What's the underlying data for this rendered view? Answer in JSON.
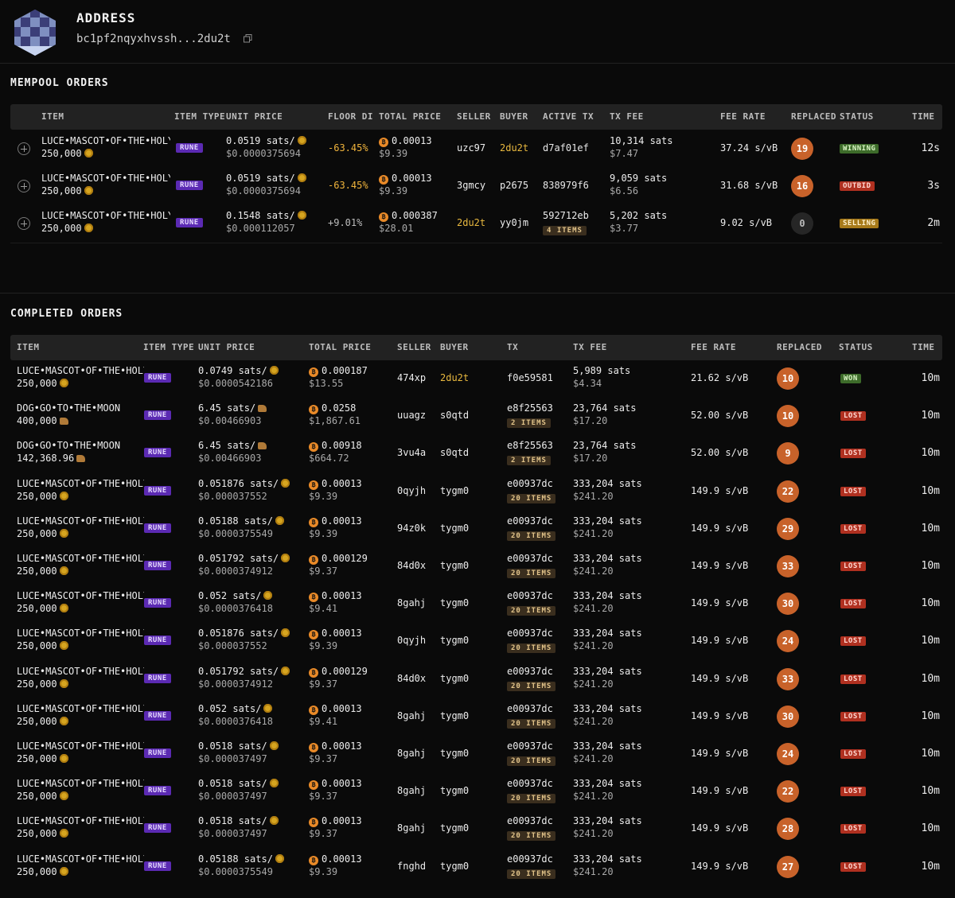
{
  "header": {
    "title": "ADDRESS",
    "address": "bc1pf2nqyxhvssh...2du2t"
  },
  "mempool": {
    "title": "MEMPOOL ORDERS",
    "columns": [
      "ITEM",
      "ITEM TYPE",
      "UNIT PRICE",
      "FLOOR DIFF",
      "TOTAL PRICE",
      "SELLER",
      "BUYER",
      "ACTIVE TX",
      "TX FEE",
      "FEE RATE",
      "REPLACED",
      "STATUS",
      "TIME"
    ],
    "rows": [
      {
        "name": "LUCE•MASCOT•OF•THE•HOLY",
        "amount": "250,000",
        "type": "RUNE",
        "unit": "0.0519 sats/",
        "unit_usd": "$0.0000375694",
        "floor": "-63.45%",
        "total": "0.00013",
        "total_usd": "$9.39",
        "seller": "uzc97",
        "buyer": "2du2t",
        "tx": "d7af01ef",
        "tx_items": "",
        "fee": "10,314 sats",
        "fee_usd": "$7.47",
        "rate": "37.24 s/vB",
        "replaced": "19",
        "status": "WINNING",
        "time": "12s"
      },
      {
        "name": "LUCE•MASCOT•OF•THE•HOLY",
        "amount": "250,000",
        "type": "RUNE",
        "unit": "0.0519 sats/",
        "unit_usd": "$0.0000375694",
        "floor": "-63.45%",
        "total": "0.00013",
        "total_usd": "$9.39",
        "seller": "3gmcy",
        "buyer": "p2675",
        "tx": "838979f6",
        "tx_items": "",
        "fee": "9,059 sats",
        "fee_usd": "$6.56",
        "rate": "31.68 s/vB",
        "replaced": "16",
        "status": "OUTBID",
        "time": "3s"
      },
      {
        "name": "LUCE•MASCOT•OF•THE•HOLY",
        "amount": "250,000",
        "type": "RUNE",
        "unit": "0.1548 sats/",
        "unit_usd": "$0.000112057",
        "floor": "+9.01%",
        "total": "0.000387",
        "total_usd": "$28.01",
        "seller": "2du2t",
        "buyer": "yy0jm",
        "tx": "592712eb",
        "tx_items": "4 ITEMS",
        "fee": "5,202 sats",
        "fee_usd": "$3.77",
        "rate": "9.02 s/vB",
        "replaced": "0",
        "status": "SELLING",
        "time": "2m"
      }
    ]
  },
  "completed": {
    "title": "COMPLETED ORDERS",
    "columns": [
      "ITEM",
      "ITEM TYPE",
      "UNIT PRICE",
      "TOTAL PRICE",
      "SELLER",
      "BUYER",
      "TX",
      "TX FEE",
      "FEE RATE",
      "REPLACED",
      "STATUS",
      "TIME"
    ],
    "rows": [
      {
        "name": "LUCE•MASCOT•OF•THE•HOLY",
        "amount": "250,000",
        "type": "RUNE",
        "unit": "0.0749 sats/",
        "unit_usd": "$0.0000542186",
        "total": "0.000187",
        "total_usd": "$13.55",
        "seller": "474xp",
        "buyer": "2du2t",
        "tx": "f0e59581",
        "tx_items": "",
        "fee": "5,989 sats",
        "fee_usd": "$4.34",
        "rate": "21.62 s/vB",
        "replaced": "10",
        "status": "WON",
        "time": "10m"
      },
      {
        "name": "DOG•GO•TO•THE•MOON",
        "amount": "400,000",
        "type": "RUNE",
        "unit": "6.45 sats/",
        "unit_usd": "$0.00466903",
        "total": "0.0258",
        "total_usd": "$1,867.61",
        "seller": "uuagz",
        "buyer": "s0qtd",
        "tx": "e8f25563",
        "tx_items": "2 ITEMS",
        "fee": "23,764 sats",
        "fee_usd": "$17.20",
        "rate": "52.00 s/vB",
        "replaced": "10",
        "status": "LOST",
        "time": "10m",
        "dog": true
      },
      {
        "name": "DOG•GO•TO•THE•MOON",
        "amount": "142,368.96",
        "type": "RUNE",
        "unit": "6.45 sats/",
        "unit_usd": "$0.00466903",
        "total": "0.00918",
        "total_usd": "$664.72",
        "seller": "3vu4a",
        "buyer": "s0qtd",
        "tx": "e8f25563",
        "tx_items": "2 ITEMS",
        "fee": "23,764 sats",
        "fee_usd": "$17.20",
        "rate": "52.00 s/vB",
        "replaced": "9",
        "status": "LOST",
        "time": "10m",
        "dog": true
      },
      {
        "name": "LUCE•MASCOT•OF•THE•HOLY",
        "amount": "250,000",
        "type": "RUNE",
        "unit": "0.051876 sats/",
        "unit_usd": "$0.000037552",
        "total": "0.00013",
        "total_usd": "$9.39",
        "seller": "0qyjh",
        "buyer": "tygm0",
        "tx": "e00937dc",
        "tx_items": "20 ITEMS",
        "fee": "333,204 sats",
        "fee_usd": "$241.20",
        "rate": "149.9 s/vB",
        "replaced": "22",
        "status": "LOST",
        "time": "10m"
      },
      {
        "name": "LUCE•MASCOT•OF•THE•HOLY",
        "amount": "250,000",
        "type": "RUNE",
        "unit": "0.05188 sats/",
        "unit_usd": "$0.0000375549",
        "total": "0.00013",
        "total_usd": "$9.39",
        "seller": "94z0k",
        "buyer": "tygm0",
        "tx": "e00937dc",
        "tx_items": "20 ITEMS",
        "fee": "333,204 sats",
        "fee_usd": "$241.20",
        "rate": "149.9 s/vB",
        "replaced": "29",
        "status": "LOST",
        "time": "10m"
      },
      {
        "name": "LUCE•MASCOT•OF•THE•HOLY",
        "amount": "250,000",
        "type": "RUNE",
        "unit": "0.051792 sats/",
        "unit_usd": "$0.0000374912",
        "total": "0.000129",
        "total_usd": "$9.37",
        "seller": "84d0x",
        "buyer": "tygm0",
        "tx": "e00937dc",
        "tx_items": "20 ITEMS",
        "fee": "333,204 sats",
        "fee_usd": "$241.20",
        "rate": "149.9 s/vB",
        "replaced": "33",
        "status": "LOST",
        "time": "10m"
      },
      {
        "name": "LUCE•MASCOT•OF•THE•HOLY",
        "amount": "250,000",
        "type": "RUNE",
        "unit": "0.052 sats/",
        "unit_usd": "$0.0000376418",
        "total": "0.00013",
        "total_usd": "$9.41",
        "seller": "8gahj",
        "buyer": "tygm0",
        "tx": "e00937dc",
        "tx_items": "20 ITEMS",
        "fee": "333,204 sats",
        "fee_usd": "$241.20",
        "rate": "149.9 s/vB",
        "replaced": "30",
        "status": "LOST",
        "time": "10m"
      },
      {
        "name": "LUCE•MASCOT•OF•THE•HOLY",
        "amount": "250,000",
        "type": "RUNE",
        "unit": "0.051876 sats/",
        "unit_usd": "$0.000037552",
        "total": "0.00013",
        "total_usd": "$9.39",
        "seller": "0qyjh",
        "buyer": "tygm0",
        "tx": "e00937dc",
        "tx_items": "20 ITEMS",
        "fee": "333,204 sats",
        "fee_usd": "$241.20",
        "rate": "149.9 s/vB",
        "replaced": "24",
        "status": "LOST",
        "time": "10m"
      },
      {
        "name": "LUCE•MASCOT•OF•THE•HOLY",
        "amount": "250,000",
        "type": "RUNE",
        "unit": "0.051792 sats/",
        "unit_usd": "$0.0000374912",
        "total": "0.000129",
        "total_usd": "$9.37",
        "seller": "84d0x",
        "buyer": "tygm0",
        "tx": "e00937dc",
        "tx_items": "20 ITEMS",
        "fee": "333,204 sats",
        "fee_usd": "$241.20",
        "rate": "149.9 s/vB",
        "replaced": "33",
        "status": "LOST",
        "time": "10m"
      },
      {
        "name": "LUCE•MASCOT•OF•THE•HOLY",
        "amount": "250,000",
        "type": "RUNE",
        "unit": "0.052 sats/",
        "unit_usd": "$0.0000376418",
        "total": "0.00013",
        "total_usd": "$9.41",
        "seller": "8gahj",
        "buyer": "tygm0",
        "tx": "e00937dc",
        "tx_items": "20 ITEMS",
        "fee": "333,204 sats",
        "fee_usd": "$241.20",
        "rate": "149.9 s/vB",
        "replaced": "30",
        "status": "LOST",
        "time": "10m"
      },
      {
        "name": "LUCE•MASCOT•OF•THE•HOLY",
        "amount": "250,000",
        "type": "RUNE",
        "unit": "0.0518 sats/",
        "unit_usd": "$0.000037497",
        "total": "0.00013",
        "total_usd": "$9.37",
        "seller": "8gahj",
        "buyer": "tygm0",
        "tx": "e00937dc",
        "tx_items": "20 ITEMS",
        "fee": "333,204 sats",
        "fee_usd": "$241.20",
        "rate": "149.9 s/vB",
        "replaced": "24",
        "status": "LOST",
        "time": "10m"
      },
      {
        "name": "LUCE•MASCOT•OF•THE•HOLY",
        "amount": "250,000",
        "type": "RUNE",
        "unit": "0.0518 sats/",
        "unit_usd": "$0.000037497",
        "total": "0.00013",
        "total_usd": "$9.37",
        "seller": "8gahj",
        "buyer": "tygm0",
        "tx": "e00937dc",
        "tx_items": "20 ITEMS",
        "fee": "333,204 sats",
        "fee_usd": "$241.20",
        "rate": "149.9 s/vB",
        "replaced": "22",
        "status": "LOST",
        "time": "10m"
      },
      {
        "name": "LUCE•MASCOT•OF•THE•HOLY",
        "amount": "250,000",
        "type": "RUNE",
        "unit": "0.0518 sats/",
        "unit_usd": "$0.000037497",
        "total": "0.00013",
        "total_usd": "$9.37",
        "seller": "8gahj",
        "buyer": "tygm0",
        "tx": "e00937dc",
        "tx_items": "20 ITEMS",
        "fee": "333,204 sats",
        "fee_usd": "$241.20",
        "rate": "149.9 s/vB",
        "replaced": "28",
        "status": "LOST",
        "time": "10m"
      },
      {
        "name": "LUCE•MASCOT•OF•THE•HOLY",
        "amount": "250,000",
        "type": "RUNE",
        "unit": "0.05188 sats/",
        "unit_usd": "$0.0000375549",
        "total": "0.00013",
        "total_usd": "$9.39",
        "seller": "fnghd",
        "buyer": "tygm0",
        "tx": "e00937dc",
        "tx_items": "20 ITEMS",
        "fee": "333,204 sats",
        "fee_usd": "$241.20",
        "rate": "149.9 s/vB",
        "replaced": "27",
        "status": "LOST",
        "time": "10m"
      }
    ]
  },
  "colors": {
    "background": "#0a0a0a",
    "header_row": "#222222",
    "rune_badge": "#5b2ab3",
    "replaced_circle": "#c8622a",
    "won": "#3d6b2a",
    "lost": "#b03020",
    "selling": "#a77a1a",
    "highlight_address": "#e9b93f"
  }
}
